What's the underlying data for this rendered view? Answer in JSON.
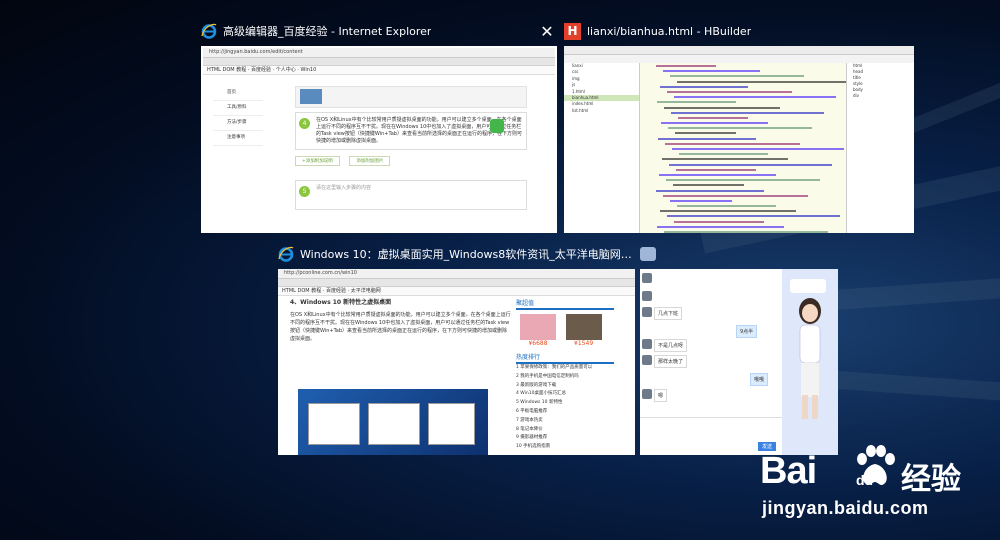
{
  "windows": [
    {
      "title": "高级编辑器_百度经验 - Internet Explorer",
      "app": "Internet Explorer",
      "content": {
        "sidebar": [
          "首页",
          "工具/原料",
          "方法/步骤",
          "注意事项"
        ],
        "step_num": "4",
        "step_text": "在OS X和Linux中有个比较常用户质疑虚拟桌面的功能，用户可以建立多个桌面，在各个桌面上运行不同的程序互不干扰。现在在Windows 10中也加入了虚拟桌面，用户可以通过任务栏的Task view按钮（快捷键Win+Tab）来查看当前所选择的桌面正在运行的程序，在下方则可快捷的增加或删除虚拟桌面。",
        "add_text": "+添加附加说明",
        "edit_text": "添加附加图片",
        "step2_num": "5",
        "step2_text": "请在这里输入步骤的内容"
      }
    },
    {
      "title": "lianxi/bianhua.html  - HBuilder",
      "app": "HBuilder",
      "icon_letter": "H",
      "file_tree": [
        "lianxi",
        "css",
        "img",
        "js",
        "1.html",
        "bianhua.html",
        "index.html",
        "list.html"
      ],
      "outline": [
        "html",
        "head",
        "title",
        "style",
        "body",
        "div"
      ]
    },
    {
      "title": "Windows 10：虚拟桌面实用_Windows8软件资讯_太平洋电脑网P...",
      "app": "Internet Explorer",
      "content": {
        "heading": "4、Windows 10 新特性之虚拟桌面",
        "body": "在OS X和Linux中有个比较常用户质疑虚拟桌面的功能，用户可以建立多个桌面，在各个桌面上运行不同的程序互不干扰。现在在Windows 10中也加入了虚拟桌面，用户可以通过任务栏的Task view按钮（快捷键Win+Tab）来查看当前所选择的桌面正在运行的程序，在下方则可快捷的增加或删除虚拟桌面。",
        "sidebar_title": "聚超值",
        "price1": "¥6688",
        "price2": "¥1549",
        "hot_title": "热度排行",
        "hot_items": [
          "1 苹果保修政策：我们的产品质量可以",
          "2 我的手机是中国电信定制机吗",
          "3 最新版的游戏下载",
          "4 Win10桌面小技巧汇总",
          "5 Windows 10 新特性",
          "6 平板电脑推荐",
          "7 游戏本热卖",
          "8 笔记本降价",
          "9 摄影器材推荐",
          "10 手机选购指南"
        ]
      }
    },
    {
      "title": "",
      "app": "QQ",
      "chat": [
        "几点下班",
        "9点半",
        "不是几点呀",
        "那样太晚了",
        "哦哦",
        "嗯"
      ]
    }
  ],
  "watermark": {
    "logo": "Bai",
    "logo2": "du",
    "cn": "经验",
    "url": "jingyan.baidu.com"
  },
  "colors": {
    "accent_green": "#8cc63f",
    "hbuilder_red": "#e2402a",
    "ie_blue": "#1e90e0",
    "desktop_blue": "#0f3b82"
  }
}
